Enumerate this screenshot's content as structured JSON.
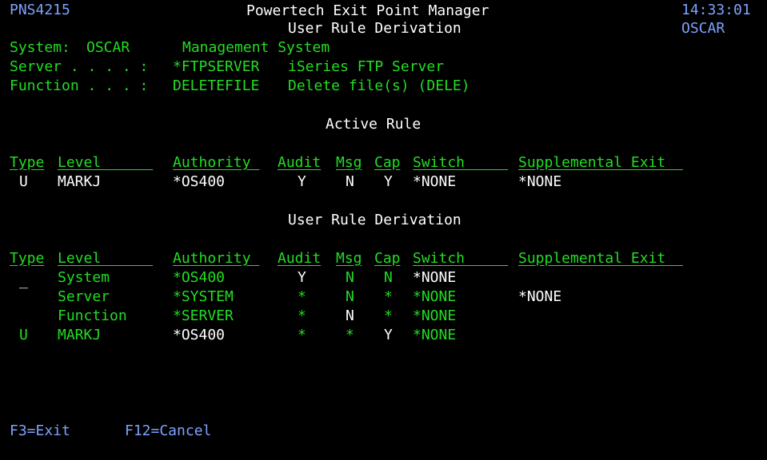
{
  "header": {
    "program_id": "PNS4215",
    "title": "Powertech Exit Point Manager",
    "subtitle": "User Rule Derivation",
    "time": "14:33:01",
    "system_name": "OSCAR"
  },
  "info": {
    "system_label": "System:",
    "system_value": "OSCAR",
    "system_desc": "Management System",
    "server_label": "Server . . . . :",
    "server_value": "*FTPSERVER",
    "server_desc": "iSeries FTP Server",
    "function_label": "Function . . . :",
    "function_value": "DELETEFILE",
    "function_desc": "Delete file(s) (DELE)"
  },
  "columns": {
    "type": "Type",
    "level": "Level      ",
    "authority": "Authority ",
    "audit": "Audit",
    "msg": "Msg",
    "cap": "Cap",
    "switch": "Switch     ",
    "supp": "Supplemental Exit  "
  },
  "active_rule": {
    "heading": "Active Rule",
    "row": {
      "type": "U",
      "level": "MARKJ",
      "authority": "*OS400",
      "audit": "Y",
      "msg": "N",
      "cap": "Y",
      "switch": "*NONE",
      "supp": "*NONE"
    }
  },
  "derivation": {
    "heading": "User Rule Derivation",
    "rows": [
      {
        "type": "_",
        "level": "System",
        "authority": "*OS400",
        "audit": "Y",
        "msg": "N",
        "cap": "N",
        "switch": "*NONE",
        "supp": ""
      },
      {
        "type": "",
        "level": "Server",
        "authority": "*SYSTEM",
        "audit": "*",
        "msg": "N",
        "cap": "*",
        "switch": "*NONE",
        "supp": "*NONE"
      },
      {
        "type": "",
        "level": "Function",
        "authority": "*SERVER",
        "audit": "*",
        "msg": "N",
        "cap": "*",
        "switch": "*NONE",
        "supp": ""
      },
      {
        "type": "U",
        "level": "MARKJ",
        "authority": "*OS400",
        "audit": "*",
        "msg": "*",
        "cap": "Y",
        "switch": "*NONE",
        "supp": ""
      }
    ]
  },
  "function_keys": {
    "f3": "F3=Exit",
    "f12": "F12=Cancel"
  }
}
